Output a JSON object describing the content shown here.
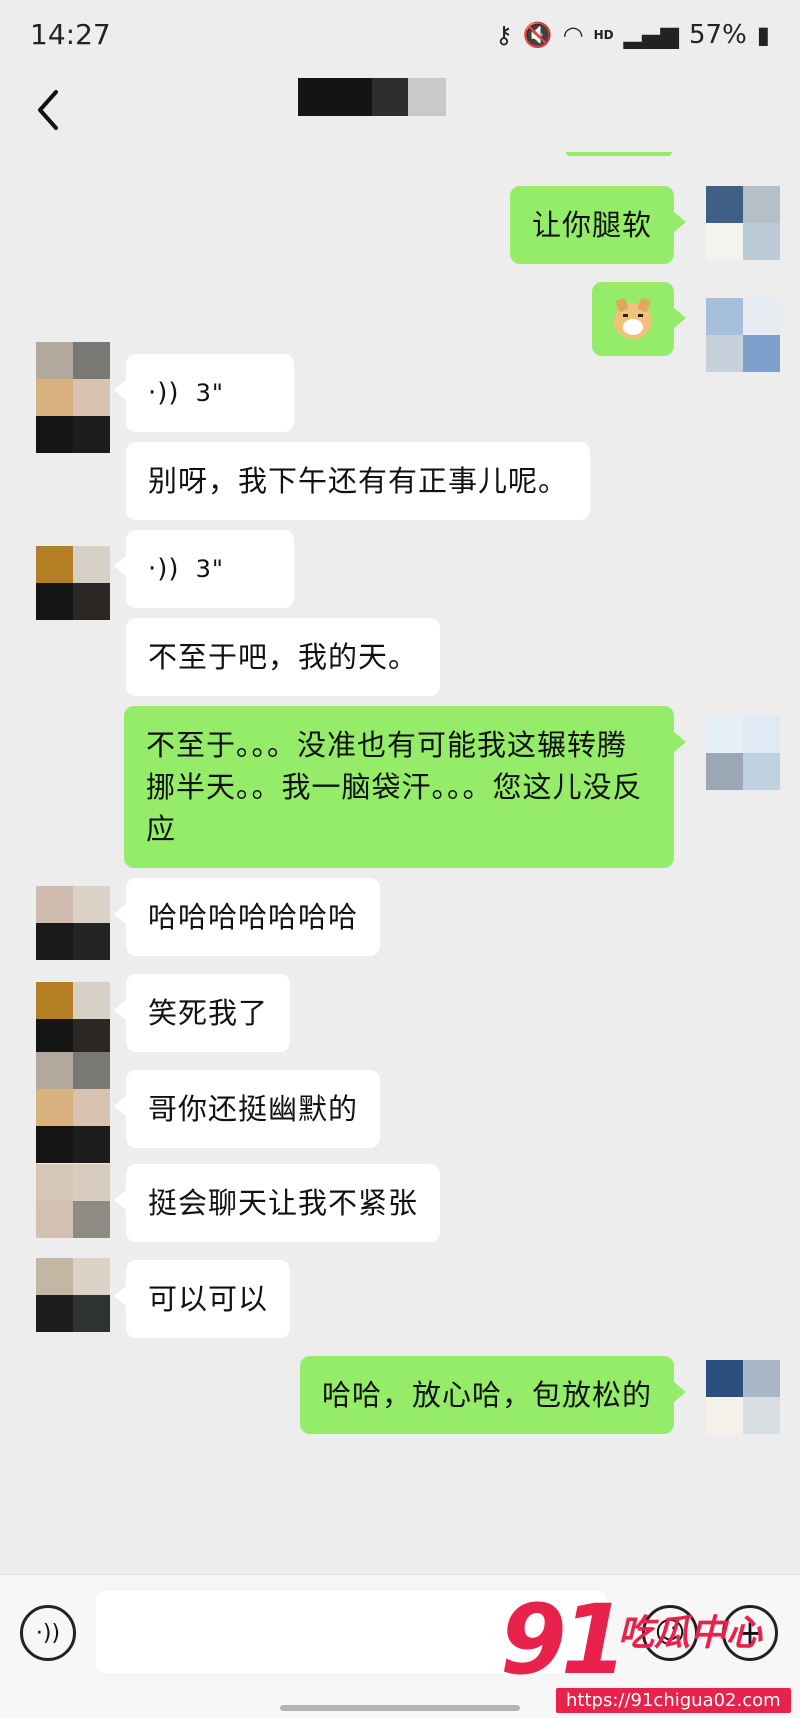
{
  "status_bar": {
    "time": "14:27",
    "network": "HD",
    "battery": "57%"
  },
  "header": {
    "title": "",
    "back_icon": "chevron-left-icon"
  },
  "messages": [
    {
      "side": "out",
      "type": "text",
      "text": "让你腿软"
    },
    {
      "side": "out",
      "type": "sticker",
      "text": "",
      "icon": "shiba-dog-emoji-icon"
    },
    {
      "side": "in",
      "type": "voice",
      "text": "3\""
    },
    {
      "side": "in",
      "type": "text",
      "text": "别呀，我下午还有有正事儿呢。"
    },
    {
      "side": "in",
      "type": "voice",
      "text": "3\""
    },
    {
      "side": "in",
      "type": "text",
      "text": "不至于吧，我的天。"
    },
    {
      "side": "out",
      "type": "text",
      "text": "不至于。。。没准也有可能我这辗转腾挪半天。。我一脑袋汗。。。您这儿没反应"
    },
    {
      "side": "in",
      "type": "text",
      "text": "哈哈哈哈哈哈哈"
    },
    {
      "side": "in",
      "type": "text",
      "text": "笑死我了"
    },
    {
      "side": "in",
      "type": "text",
      "text": "哥你还挺幽默的"
    },
    {
      "side": "in",
      "type": "text",
      "text": "挺会聊天让我不紧张"
    },
    {
      "side": "in",
      "type": "text",
      "text": "可以可以"
    },
    {
      "side": "out",
      "type": "text",
      "text": "哈哈，放心哈，包放松的"
    }
  ],
  "input_bar": {
    "placeholder": "",
    "voice_icon": "voice-mode-icon",
    "emoji_icon": "emoji-icon",
    "plus_icon": "plus-icon"
  },
  "watermark": {
    "number": "91",
    "name": "吃瓜中心",
    "url": "https://91chigua02.com"
  },
  "colors": {
    "background": "#ededed",
    "outgoing_bubble": "#95ec69",
    "incoming_bubble": "#ffffff",
    "watermark": "#e8224a"
  }
}
